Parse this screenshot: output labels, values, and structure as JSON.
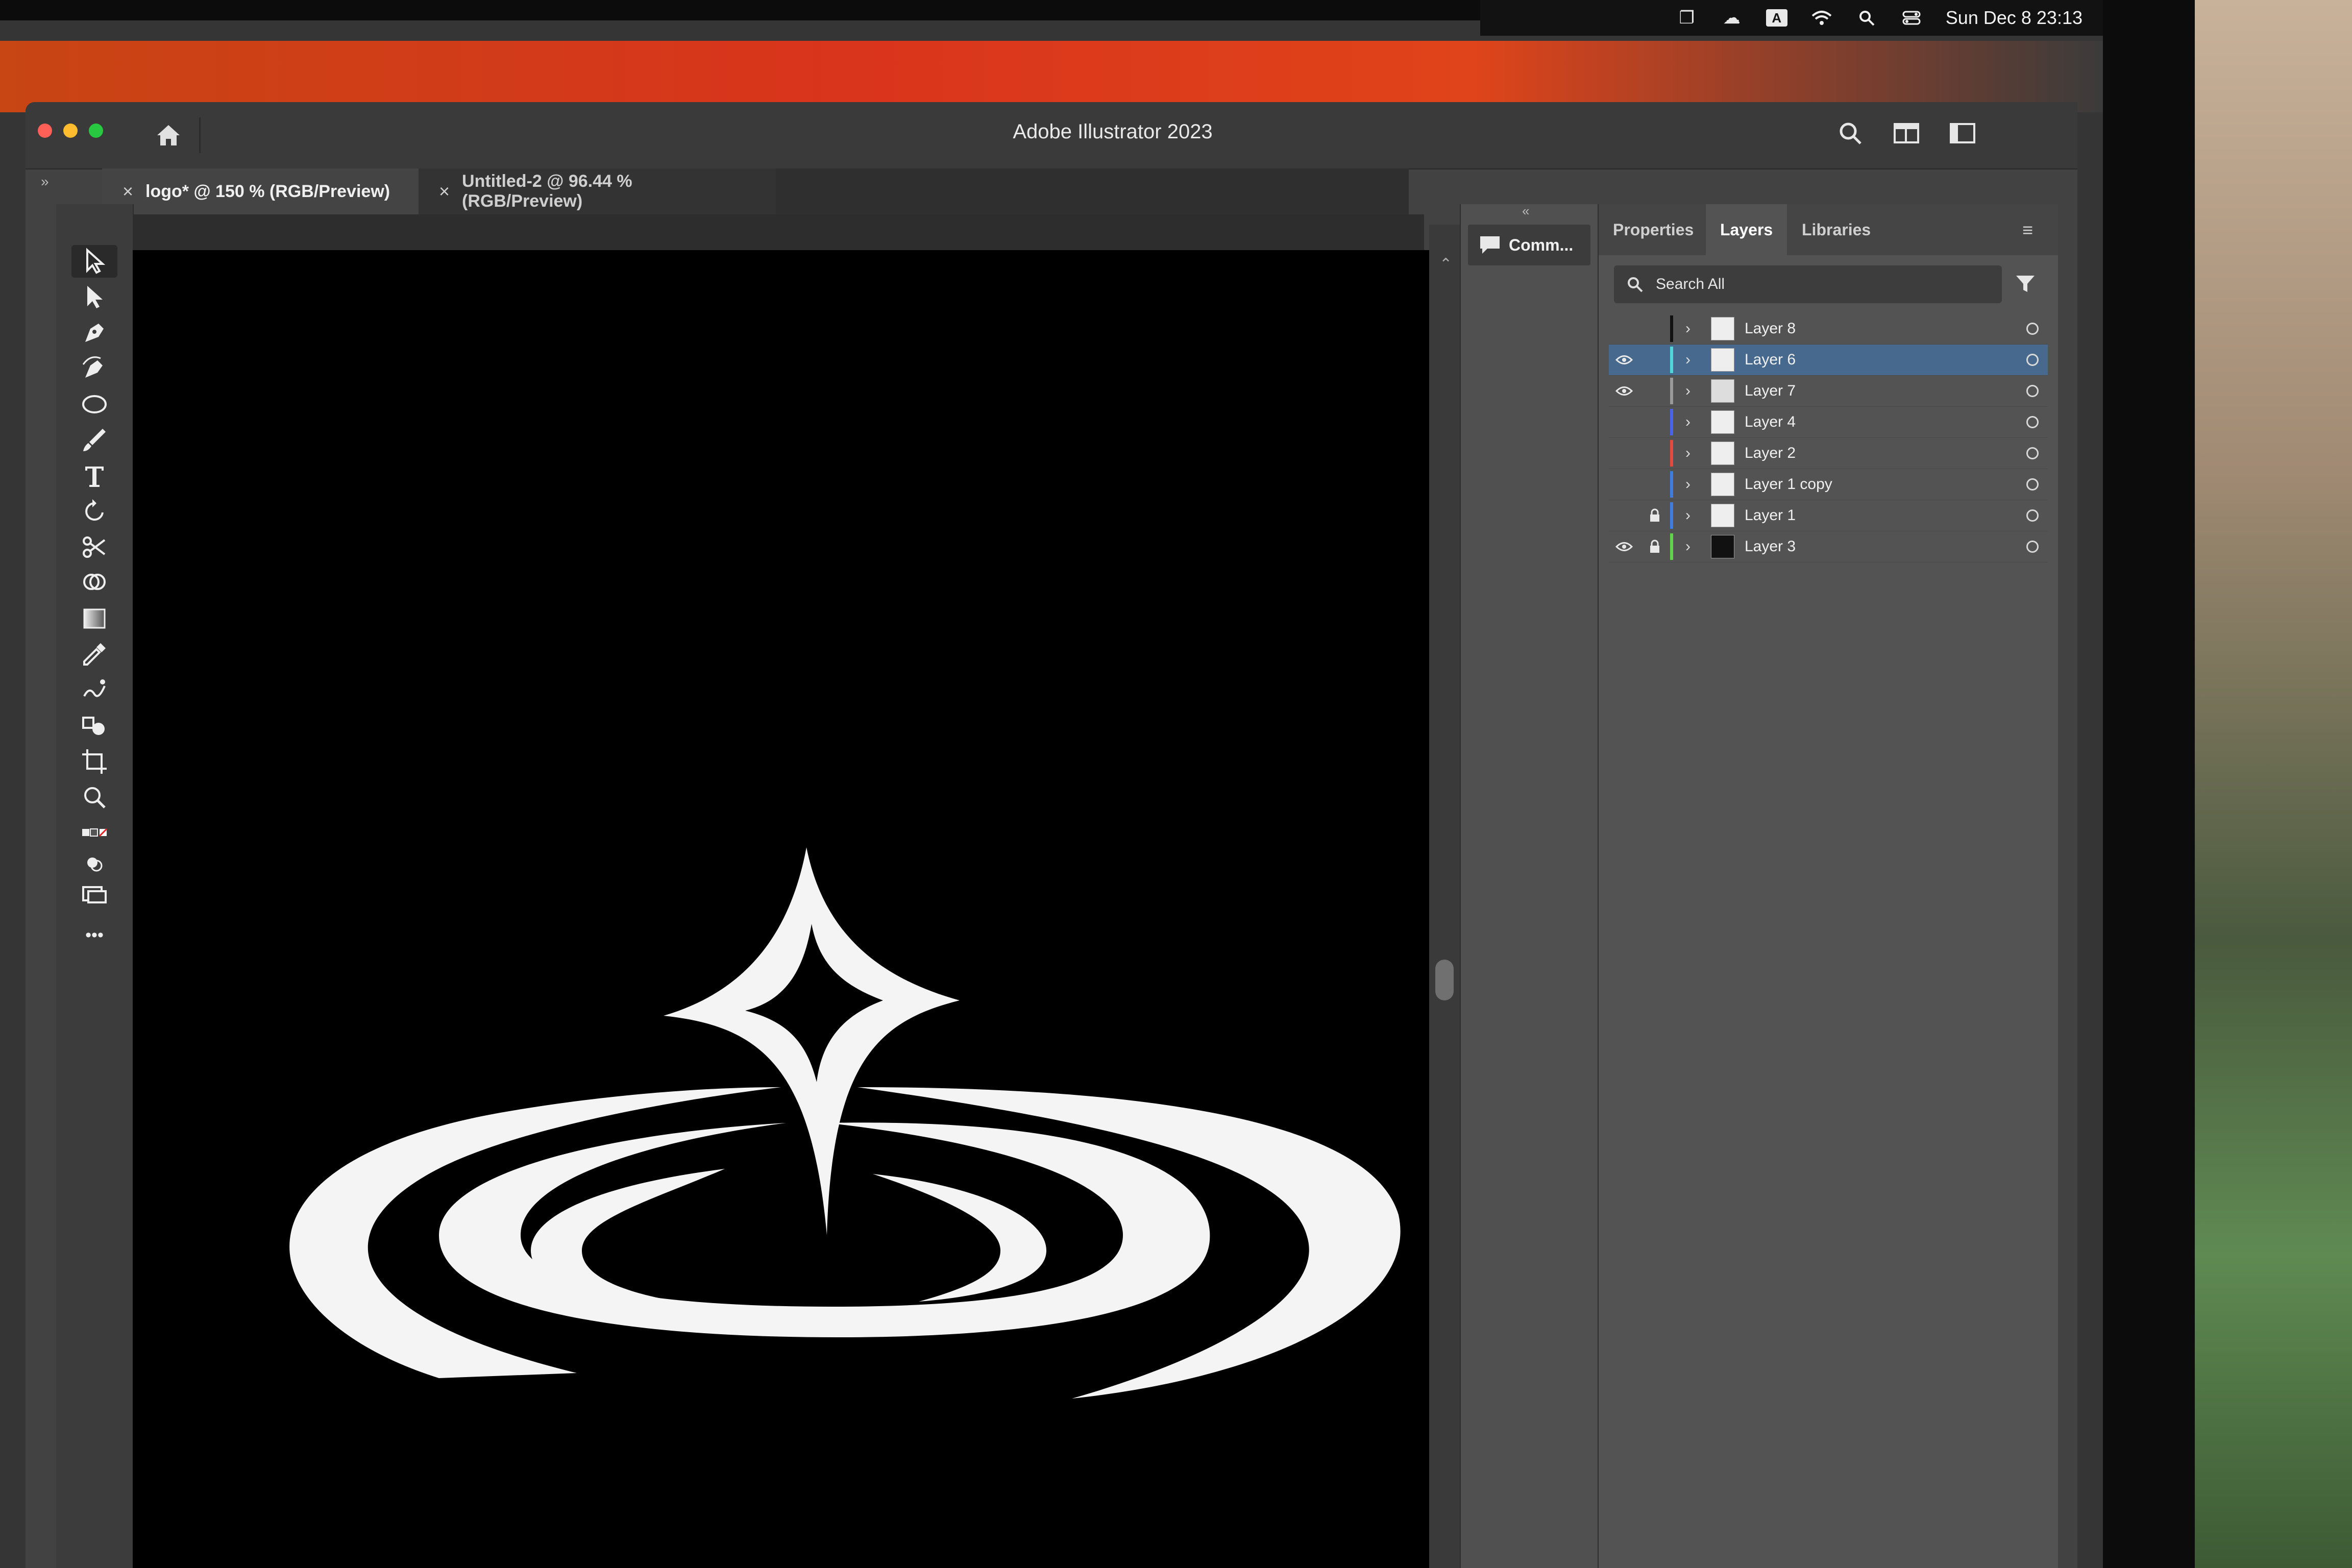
{
  "menubar": {
    "clock": "Sun Dec 8  23:13",
    "icons": [
      "window-stack-icon",
      "creative-cloud-icon",
      "input-source-icon",
      "wifi-icon",
      "spotlight-search-icon",
      "control-center-icon"
    ]
  },
  "app": {
    "title": "Adobe Illustrator 2023"
  },
  "tabs": [
    {
      "label": "logo* @ 150 % (RGB/Preview)",
      "active": true
    },
    {
      "label": "Untitled-2 @ 96.44 % (RGB/Preview)",
      "active": false
    }
  ],
  "toolbar": {
    "tools": [
      "selection-tool",
      "direct-selection-tool",
      "pen-tool",
      "curvature-tool",
      "ellipse-tool",
      "paintbrush-tool",
      "type-tool",
      "rotate-tool",
      "scissors-tool",
      "shape-builder-tool",
      "rectangle-tool",
      "eyedropper-tool",
      "puppet-warp-tool",
      "blend-tool",
      "artboard-tool",
      "zoom-tool",
      "fill-stroke-swatch",
      "draw-mode",
      "screen-mode",
      "more-tools"
    ],
    "more_label": "•••"
  },
  "comments": {
    "label": "Comm..."
  },
  "panel": {
    "tabs": [
      "Properties",
      "Layers",
      "Libraries"
    ],
    "active_tab": "Layers",
    "search_placeholder": "Search All",
    "layers": [
      {
        "name": "Layer 8",
        "visible": false,
        "locked": false,
        "color": "#111111",
        "thumb": "#eeeeee",
        "selected": false
      },
      {
        "name": "Layer 6",
        "visible": true,
        "locked": false,
        "color": "#4fd6d6",
        "thumb": "#eeeeee",
        "selected": true
      },
      {
        "name": "Layer 7",
        "visible": true,
        "locked": false,
        "color": "#9a9a9a",
        "thumb": "#dddddd",
        "selected": false
      },
      {
        "name": "Layer 4",
        "visible": false,
        "locked": false,
        "color": "#4c63e6",
        "thumb": "#eeeeee",
        "selected": false
      },
      {
        "name": "Layer 2",
        "visible": false,
        "locked": false,
        "color": "#e04b3a",
        "thumb": "#eeeeee",
        "selected": false
      },
      {
        "name": "Layer 1 copy",
        "visible": false,
        "locked": false,
        "color": "#3d7de0",
        "thumb": "#eeeeee",
        "selected": false
      },
      {
        "name": "Layer 1",
        "visible": false,
        "locked": true,
        "color": "#3d7de0",
        "thumb": "#eeeeee",
        "selected": false
      },
      {
        "name": "Layer 3",
        "visible": true,
        "locked": true,
        "color": "#5fd34a",
        "thumb": "#111111",
        "selected": false
      }
    ]
  },
  "colors": {
    "accent_selected_row": "#46698d",
    "artboard": "#000000",
    "logo": "#ffffff"
  }
}
